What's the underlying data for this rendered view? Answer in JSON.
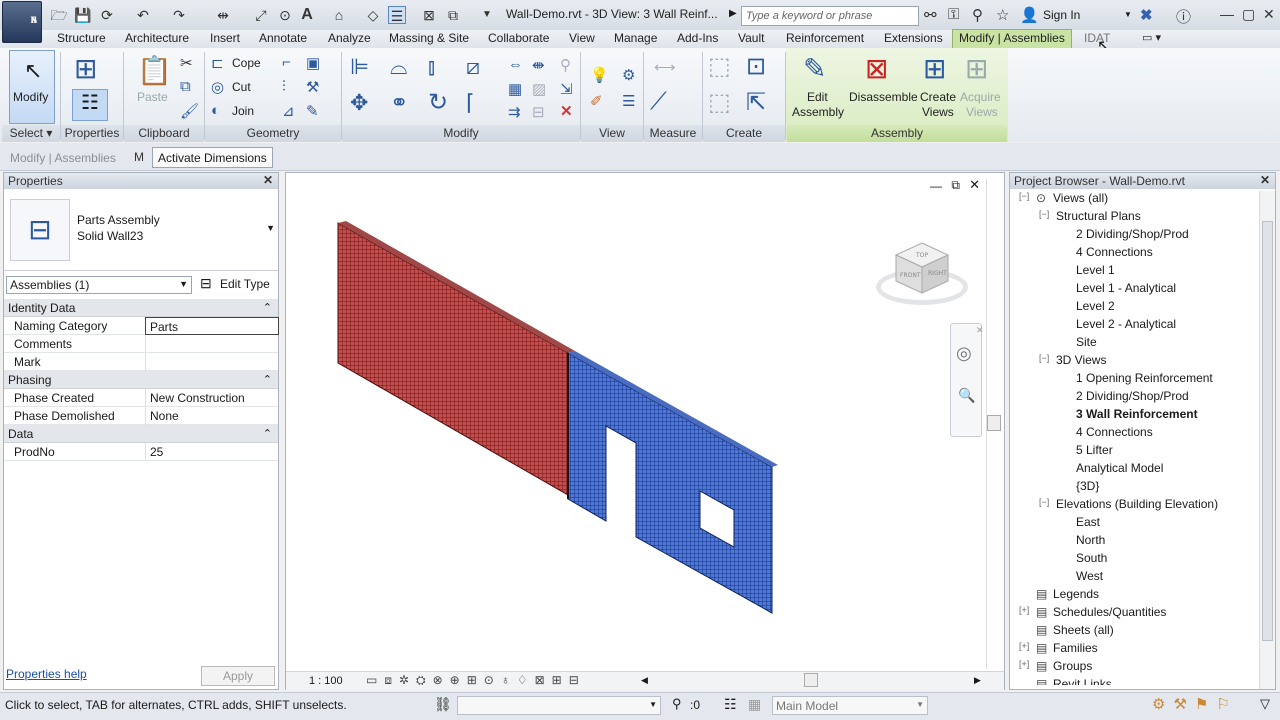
{
  "title_bar": {
    "doc_title": "Wall-Demo.rvt - 3D View: 3 Wall Reinf...",
    "search_placeholder": "Type a keyword or phrase",
    "sign_in": "Sign In",
    "app_letter": "R",
    "app_sub": "S"
  },
  "tabs": [
    "Structure",
    "Architecture",
    "Insert",
    "Annotate",
    "Analyze",
    "Massing & Site",
    "Collaborate",
    "View",
    "Manage",
    "Add-Ins",
    "Vault",
    "Reinforcement",
    "Extensions",
    "Modify | Assemblies",
    "IDAT"
  ],
  "ribbon": {
    "modify": "Modify",
    "select": "Select",
    "properties": "Properties",
    "clipboard": "Clipboard",
    "paste": "Paste",
    "cope": "Cope",
    "cut": "Cut",
    "join": "Join",
    "geometry": "Geometry",
    "modify_panel": "Modify",
    "view_panel": "View",
    "measure_panel": "Measure",
    "create_panel": "Create",
    "edit_assembly": [
      "Edit",
      "Assembly"
    ],
    "disassemble": "Disassemble",
    "create_views": [
      "Create",
      "Views"
    ],
    "acquire_views": [
      "Acquire",
      "Views"
    ],
    "assembly_panel": "Assembly"
  },
  "options_bar": {
    "context": "Modify | Assemblies",
    "activate_dimensions": "Activate Dimensions"
  },
  "properties": {
    "title": "Properties",
    "type_line1": "Parts Assembly",
    "type_line2": "Solid Wall23",
    "selector": "Assemblies (1)",
    "edit_type": "Edit Type",
    "sections": [
      {
        "name": "Identity Data",
        "rows": [
          [
            "Naming Category",
            "Parts"
          ],
          [
            "Comments",
            ""
          ],
          [
            "Mark",
            ""
          ]
        ]
      },
      {
        "name": "Phasing",
        "rows": [
          [
            "Phase Created",
            "New Construction"
          ],
          [
            "Phase Demolished",
            "None"
          ]
        ]
      },
      {
        "name": "Data",
        "rows": [
          [
            "ProdNo",
            "25"
          ]
        ]
      }
    ],
    "help": "Properties help",
    "apply": "Apply"
  },
  "view": {
    "scale": "1 : 100",
    "cube_top": "TOP",
    "cube_front": "FRONT",
    "cube_right": "RIGHT",
    "colors": {
      "red": "#9a2020",
      "blue": "#1f4fb5"
    }
  },
  "browser": {
    "title": "Project Browser - Wall-Demo.rvt",
    "items": [
      {
        "label": "Views (all)",
        "level": 0,
        "exp": "−"
      },
      {
        "label": "Structural Plans",
        "level": 1,
        "exp": "−"
      },
      {
        "label": "2 Dividing/Shop/Prod",
        "level": 2
      },
      {
        "label": "4 Connections",
        "level": 2
      },
      {
        "label": "Level 1",
        "level": 2
      },
      {
        "label": "Level 1 - Analytical",
        "level": 2
      },
      {
        "label": "Level 2",
        "level": 2
      },
      {
        "label": "Level 2 - Analytical",
        "level": 2
      },
      {
        "label": "Site",
        "level": 2
      },
      {
        "label": "3D Views",
        "level": 1,
        "exp": "−"
      },
      {
        "label": "1 Opening Reinforcement",
        "level": 2
      },
      {
        "label": "2 Dividing/Shop/Prod",
        "level": 2
      },
      {
        "label": "3 Wall Reinforcement",
        "level": 2,
        "bold": true
      },
      {
        "label": "4 Connections",
        "level": 2
      },
      {
        "label": "5 Lifter",
        "level": 2
      },
      {
        "label": "Analytical Model",
        "level": 2
      },
      {
        "label": "{3D}",
        "level": 2
      },
      {
        "label": "Elevations (Building Elevation)",
        "level": 1,
        "exp": "−"
      },
      {
        "label": "East",
        "level": 2
      },
      {
        "label": "North",
        "level": 2
      },
      {
        "label": "South",
        "level": 2
      },
      {
        "label": "West",
        "level": 2
      },
      {
        "label": "Legends",
        "level": 0,
        "icon": true
      },
      {
        "label": "Schedules/Quantities",
        "level": 0,
        "icon": true,
        "exp": "+"
      },
      {
        "label": "Sheets (all)",
        "level": 0,
        "icon": true
      },
      {
        "label": "Families",
        "level": 0,
        "icon": true,
        "exp": "+"
      },
      {
        "label": "Groups",
        "level": 0,
        "icon": true,
        "exp": "+"
      },
      {
        "label": "Revit Links",
        "level": 0,
        "icon": true
      }
    ]
  },
  "status": {
    "hint": "Click to select, TAB for alternates, CTRL adds, SHIFT unselects.",
    "count": ":0",
    "model": "Main Model"
  }
}
